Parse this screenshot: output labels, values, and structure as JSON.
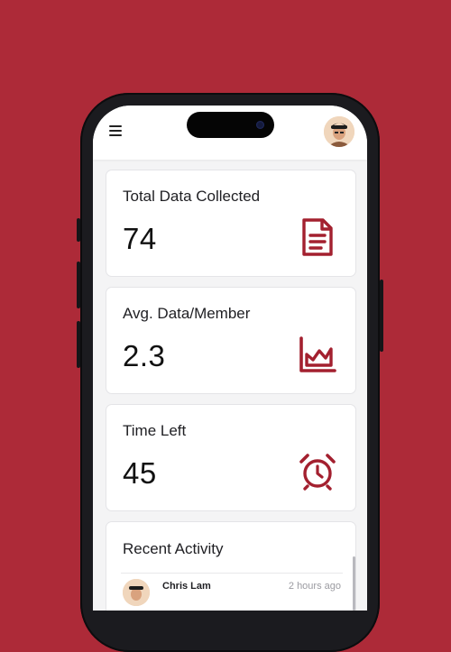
{
  "header": {
    "menu_icon": "hamburger-menu-icon",
    "avatar_icon": "user-avatar"
  },
  "stats": [
    {
      "label": "Total Data Collected",
      "value": "74",
      "icon": "document-icon"
    },
    {
      "label": "Avg. Data/Member",
      "value": "2.3",
      "icon": "area-chart-icon"
    },
    {
      "label": "Time Left",
      "value": "45",
      "icon": "alarm-clock-icon"
    }
  ],
  "recent_activity": {
    "title": "Recent Activity",
    "items": [
      {
        "name": "Chris Lam",
        "time": "2 hours ago"
      }
    ]
  },
  "colors": {
    "background": "#ad2a38",
    "accent": "#a3202f",
    "card": "#ffffff",
    "screen": "#f4f4f5"
  }
}
